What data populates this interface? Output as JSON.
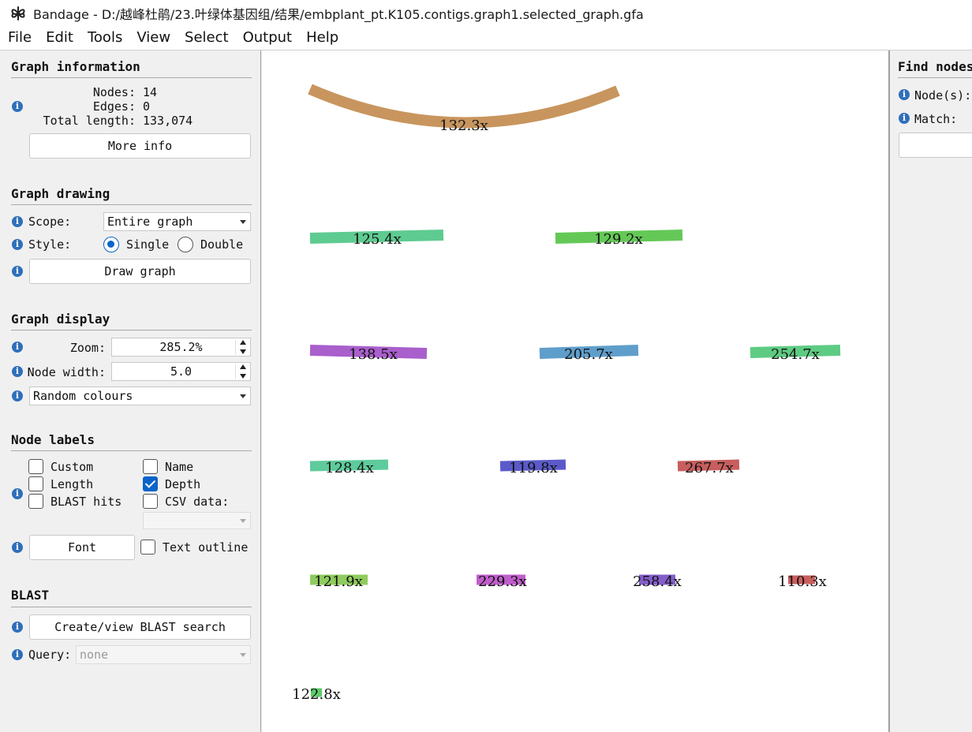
{
  "window": {
    "title": "Bandage - D:/越峰杜鹃/23.叶绿体基因组/结果/embplant_pt.K105.contigs.graph1.selected_graph.gfa",
    "icon": "bandage-logo-icon"
  },
  "menu": [
    "File",
    "Edit",
    "Tools",
    "View",
    "Select",
    "Output",
    "Help"
  ],
  "graph_information": {
    "title": "Graph information",
    "nodes_label": "Nodes:",
    "nodes_value": "14",
    "edges_label": "Edges:",
    "edges_value": "0",
    "length_label": "Total length:",
    "length_value": "133,074",
    "more_info": "More info"
  },
  "graph_drawing": {
    "title": "Graph drawing",
    "scope_label": "Scope:",
    "scope_value": "Entire graph",
    "style_label": "Style:",
    "style_single": "Single",
    "style_double": "Double",
    "style_selected": "Single",
    "draw_button": "Draw graph"
  },
  "graph_display": {
    "title": "Graph display",
    "zoom_label": "Zoom:",
    "zoom_value": "285.2%",
    "node_width_label": "Node width:",
    "node_width_value": "5.0",
    "colour_scheme": "Random colours"
  },
  "node_labels": {
    "title": "Node labels",
    "custom": "Custom",
    "name": "Name",
    "length": "Length",
    "depth": "Depth",
    "blast_hits": "BLAST hits",
    "csv_data": "CSV data:",
    "depth_checked": true,
    "font_button": "Font",
    "text_outline": "Text outline"
  },
  "blast": {
    "title": "BLAST",
    "create_button": "Create/view BLAST search",
    "query_label": "Query:",
    "query_value": "none"
  },
  "find_nodes": {
    "title": "Find nodes",
    "nodes_label": "Node(s):",
    "match_label": "Match:"
  },
  "graph_nodes": [
    {
      "label": "132.3x",
      "color": "#c8955e"
    },
    {
      "label": "125.4x",
      "color": "#5ecb91"
    },
    {
      "label": "129.2x",
      "color": "#64c857"
    },
    {
      "label": "138.5x",
      "color": "#a95fcc"
    },
    {
      "label": "205.7x",
      "color": "#5f9ecb"
    },
    {
      "label": "254.7x",
      "color": "#5ecb83"
    },
    {
      "label": "128.4x",
      "color": "#5ecb9c"
    },
    {
      "label": "119.8x",
      "color": "#5b5ac9"
    },
    {
      "label": "267.7x",
      "color": "#c85e5e"
    },
    {
      "label": "121.9x",
      "color": "#8fcb5e"
    },
    {
      "label": "229.3x",
      "color": "#c05ecb"
    },
    {
      "label": "258.4x",
      "color": "#845ecb"
    },
    {
      "label": "110.3x",
      "color": "#cb5e5e"
    },
    {
      "label": "122.8x",
      "color": "#5ecb6a"
    }
  ]
}
